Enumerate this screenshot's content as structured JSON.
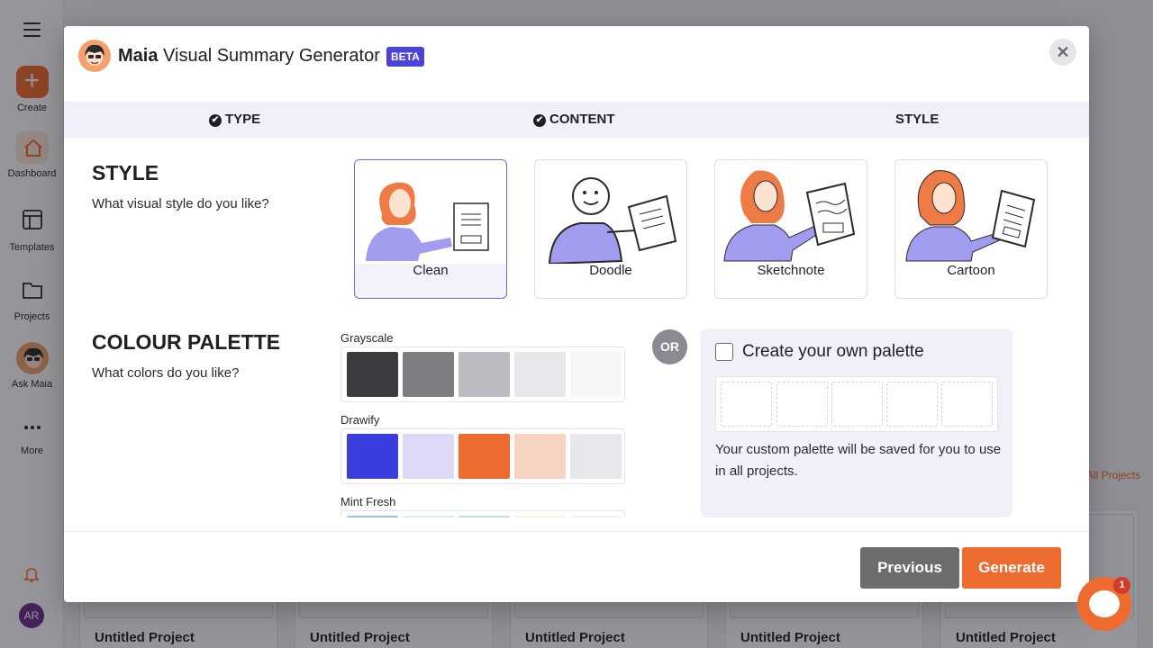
{
  "sidebar": {
    "items": [
      {
        "label": "Create",
        "icon": "plus-icon"
      },
      {
        "label": "Dashboard",
        "icon": "home-icon"
      },
      {
        "label": "Templates",
        "icon": "templates-icon"
      },
      {
        "label": "Projects",
        "icon": "folder-icon"
      },
      {
        "label": "Ask Maia",
        "icon": "maia-avatar-icon"
      },
      {
        "label": "More",
        "icon": "more-dots-icon"
      }
    ],
    "user_initials": "AR"
  },
  "background": {
    "all_projects_link": "All Projects",
    "project_titles": [
      "Untitled Project",
      "Untitled Project",
      "Untitled Project",
      "Untitled Project",
      "Untitled Project"
    ]
  },
  "modal": {
    "title_bold": "Maia",
    "title_rest": " Visual Summary Generator",
    "badge": "BETA",
    "close_symbol": "✕",
    "steps": [
      {
        "label": "TYPE",
        "done": true
      },
      {
        "label": "CONTENT",
        "done": true
      },
      {
        "label": "STYLE",
        "done": false
      }
    ],
    "style_section": {
      "title": "STYLE",
      "subtitle": "What visual style do you like?",
      "options": [
        {
          "label": "Clean",
          "selected": true
        },
        {
          "label": "Doodle",
          "selected": false
        },
        {
          "label": "Sketchnote",
          "selected": false
        },
        {
          "label": "Cartoon",
          "selected": false
        }
      ]
    },
    "palette_section": {
      "title": "COLOUR PALETTE",
      "subtitle": "What colors do you like?",
      "palettes": [
        {
          "name": "Grayscale",
          "colors": [
            "#3c3c40",
            "#7d7d82",
            "#bbbbc2",
            "#e8e8ec",
            "#f6f6f8"
          ]
        },
        {
          "name": "Drawify",
          "colors": [
            "#3b3ddc",
            "#ddd8f6",
            "#ee6b2f",
            "#f7d3c3",
            "#e8e8ec"
          ]
        },
        {
          "name": "Mint Fresh",
          "colors": [
            "#9cc3dc",
            "#d8eef6",
            "#bfe3c8",
            "#f3f6d8",
            "#f0f0f0"
          ]
        }
      ],
      "or_label": "OR",
      "custom": {
        "checkbox_checked": false,
        "title": "Create your own palette",
        "description": "Your custom palette will be saved for you to use in all projects."
      }
    },
    "footer": {
      "previous_label": "Previous",
      "generate_label": "Generate"
    }
  },
  "chat": {
    "unread_count": "1"
  },
  "colors": {
    "accent": "#ee6b2f",
    "brand_blue": "#4a44d8",
    "selected_border": "#6b6bd8"
  }
}
